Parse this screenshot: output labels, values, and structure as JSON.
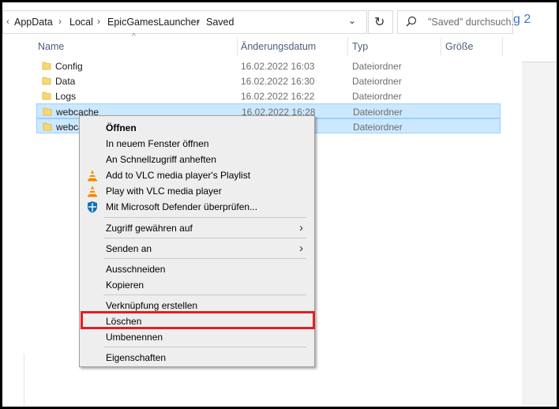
{
  "address_bar": {
    "back_chevron": "‹",
    "segments": [
      "AppData",
      "Local",
      "EpicGamesLauncher",
      "Saved"
    ],
    "separator": "›",
    "dropdown": "⌄"
  },
  "refresh": {
    "icon": "refresh-icon"
  },
  "search": {
    "placeholder": "\"Saved\" durchsuch..."
  },
  "right_pane_fragment": "g 2",
  "columns": {
    "name": "Name",
    "date": "Änderungsdatum",
    "type": "Typ",
    "size": "Größe"
  },
  "files": [
    {
      "name": "Config",
      "date": "16.02.2022 16:03",
      "type": "Dateiordner",
      "selected": false
    },
    {
      "name": "Data",
      "date": "16.02.2022 16:30",
      "type": "Dateiordner",
      "selected": false
    },
    {
      "name": "Logs",
      "date": "16.02.2022 16:22",
      "type": "Dateiordner",
      "selected": false
    },
    {
      "name": "webcache",
      "date": "16.02.2022 16:28",
      "type": "Dateiordner",
      "selected": true
    },
    {
      "name": "webca",
      "date": "",
      "type": "Dateiordner",
      "selected": true
    }
  ],
  "context_menu": {
    "open": "Öffnen",
    "open_new_window": "In neuem Fenster öffnen",
    "pin_quick_access": "An Schnellzugriff anheften",
    "vlc_add_playlist": "Add to VLC media player's Playlist",
    "vlc_play": "Play with VLC media player",
    "defender_scan": "Mit Microsoft Defender überprüfen...",
    "give_access": "Zugriff gewähren auf",
    "send_to": "Senden an",
    "cut": "Ausschneiden",
    "copy": "Kopieren",
    "create_shortcut": "Verknüpfung erstellen",
    "delete": "Löschen",
    "rename": "Umbenennen",
    "properties": "Eigenschaften",
    "submenu_arrow": "›"
  },
  "colors": {
    "selection_bg": "#cce8ff",
    "highlight_border": "#e31e24",
    "folder_yellow": "#f8d775",
    "vlc_orange": "#f08a00",
    "defender_blue": "#0a6ebd"
  }
}
